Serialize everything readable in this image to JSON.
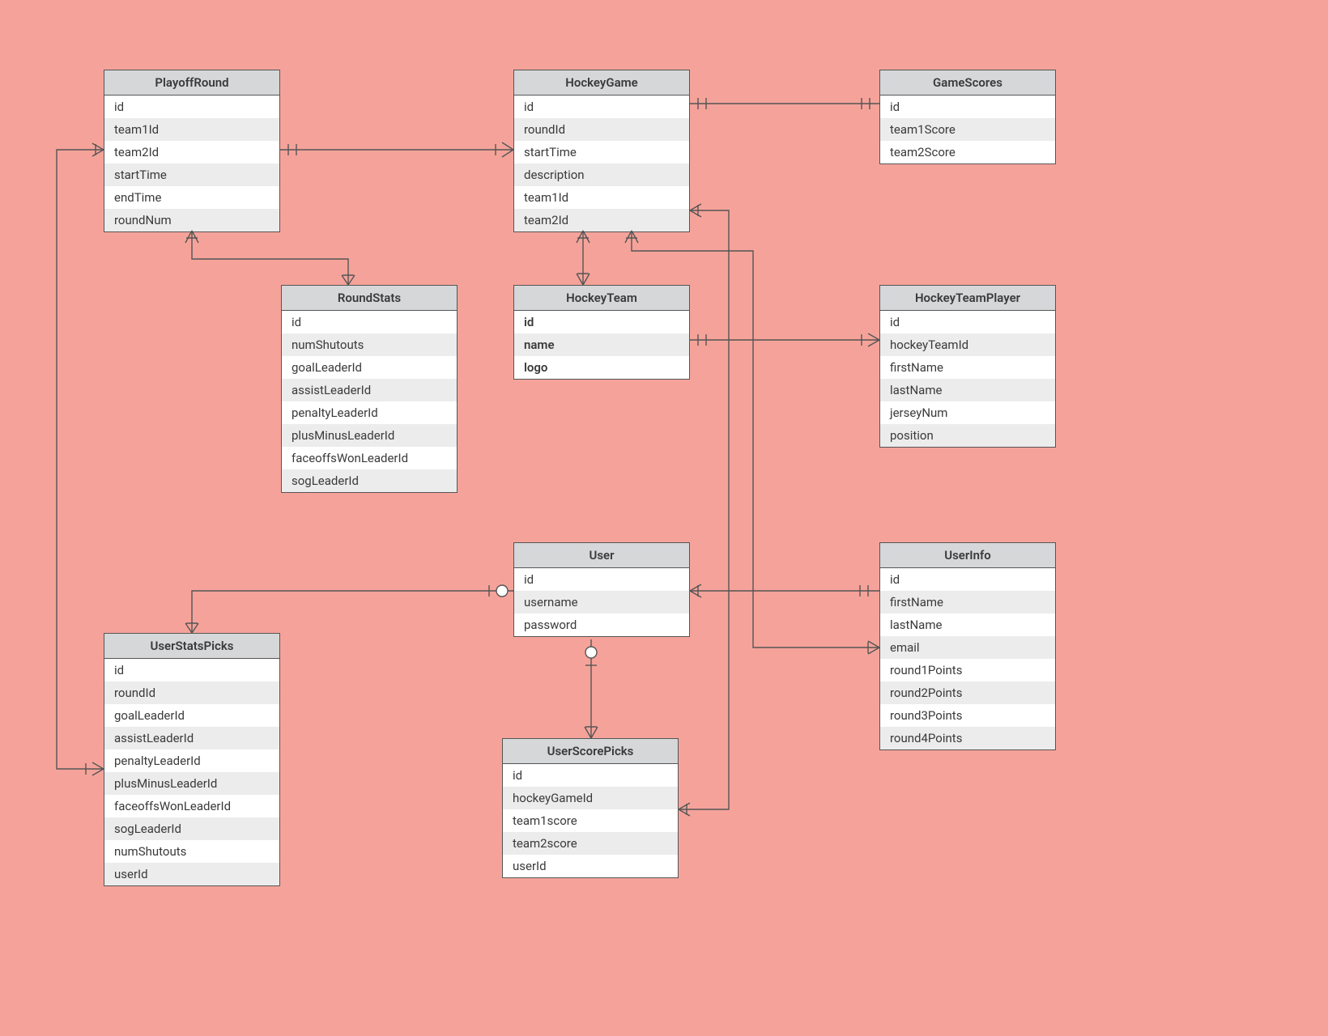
{
  "entities": {
    "playoffRound": {
      "title": "PlayoffRound",
      "fields": [
        "id",
        "team1Id",
        "team2Id",
        "startTime",
        "endTime",
        "roundNum"
      ]
    },
    "hockeyGame": {
      "title": "HockeyGame",
      "fields": [
        "id",
        "roundId",
        "startTime",
        "description",
        "team1Id",
        "team2Id"
      ]
    },
    "gameScores": {
      "title": "GameScores",
      "fields": [
        "id",
        "team1Score",
        "team2Score"
      ]
    },
    "roundStats": {
      "title": "RoundStats",
      "fields": [
        "id",
        "numShutouts",
        "goalLeaderId",
        "assistLeaderId",
        "penaltyLeaderId",
        "plusMinusLeaderId",
        "faceoffsWonLeaderId",
        "sogLeaderId"
      ]
    },
    "hockeyTeam": {
      "title": "HockeyTeam",
      "fields": [
        "id",
        "name",
        "logo"
      ]
    },
    "hockeyTeamPlayer": {
      "title": "HockeyTeamPlayer",
      "fields": [
        "id",
        "hockeyTeamId",
        "firstName",
        "lastName",
        "jerseyNum",
        "position"
      ]
    },
    "user": {
      "title": "User",
      "fields": [
        "id",
        "username",
        "password"
      ]
    },
    "userInfo": {
      "title": "UserInfo",
      "fields": [
        "id",
        "firstName",
        "lastName",
        "email",
        "round1Points",
        "round2Points",
        "round3Points",
        "round4Points"
      ]
    },
    "userStatsPicks": {
      "title": "UserStatsPicks",
      "fields": [
        "id",
        "roundId",
        "goalLeaderId",
        "assistLeaderId",
        "penaltyLeaderId",
        "plusMinusLeaderId",
        "faceoffsWonLeaderId",
        "sogLeaderId",
        "numShutouts",
        "userId"
      ]
    },
    "userScorePicks": {
      "title": "UserScorePicks",
      "fields": [
        "id",
        "hockeyGameId",
        "team1score",
        "team2score",
        "userId"
      ]
    }
  }
}
